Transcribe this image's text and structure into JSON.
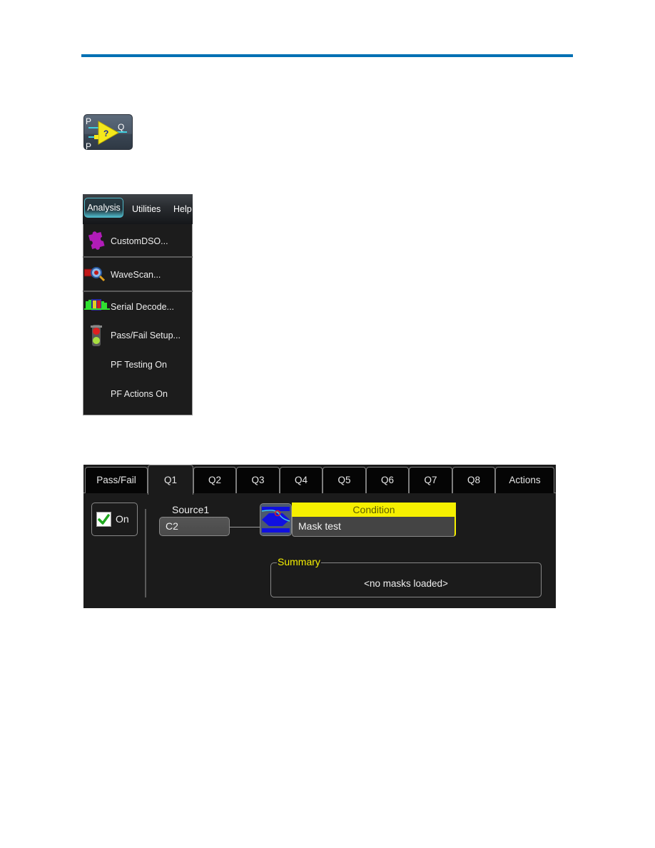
{
  "document": {
    "accent_color": "#0070b4"
  },
  "function_icon": {
    "name": "pass-fail-qualifier-icon",
    "input_labels": [
      "P",
      "P"
    ],
    "output_label": "Q",
    "center_symbol": "?"
  },
  "menu": {
    "menubar": [
      "Analysis",
      "Utilities",
      "Help"
    ],
    "active_menu": "Analysis",
    "items": [
      {
        "label": "CustomDSO...",
        "icon": "puzzle-piece-icon"
      },
      {
        "label": "WaveScan...",
        "icon": "wavescan-magnifier-icon"
      },
      {
        "label": "Serial Decode...",
        "icon": "serial-decode-icon"
      },
      {
        "label": "Pass/Fail Setup...",
        "icon": "traffic-light-icon"
      },
      {
        "label": "PF Testing On",
        "icon": ""
      },
      {
        "label": "PF Actions On",
        "icon": ""
      }
    ]
  },
  "dialog": {
    "tabs": [
      "Pass/Fail",
      "Q1",
      "Q2",
      "Q3",
      "Q4",
      "Q5",
      "Q6",
      "Q7",
      "Q8",
      "Actions"
    ],
    "active_tab": "Q1",
    "on_checkbox": {
      "label": "On",
      "checked": true
    },
    "source1": {
      "label": "Source1",
      "value": "C2"
    },
    "condition": {
      "label": "Condition",
      "value": "Mask test",
      "icon": "mask-test-icon"
    },
    "summary": {
      "label": "Summary",
      "text": "<no masks loaded>"
    }
  }
}
